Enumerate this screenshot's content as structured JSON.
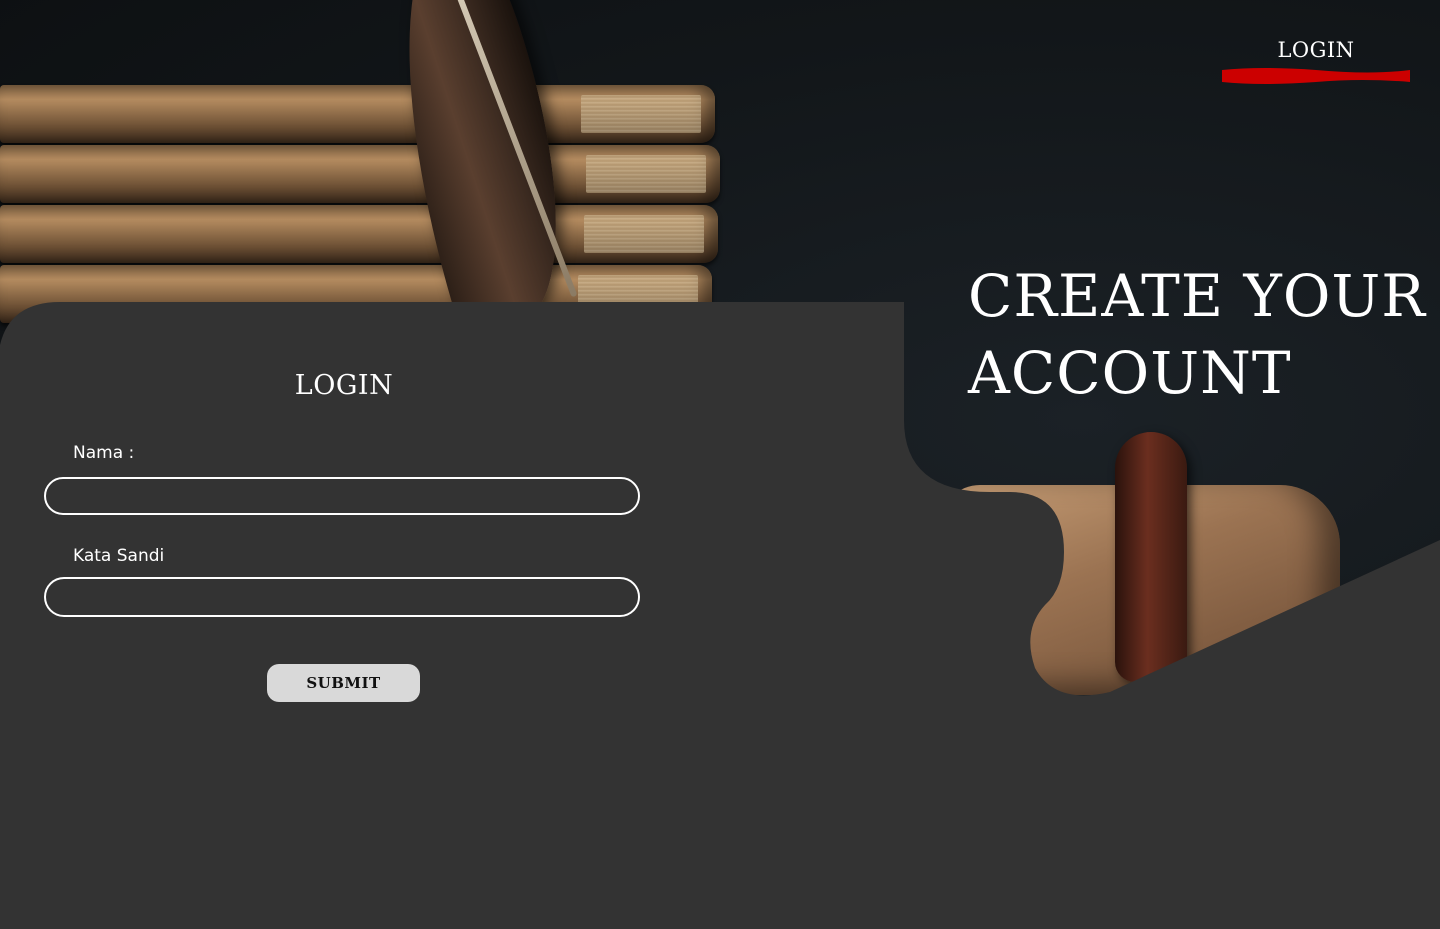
{
  "nav": {
    "login_label": "LOGIN",
    "accent_color": "#cc0000"
  },
  "hero": {
    "headline_line1": "CREATE YOUR",
    "headline_line2": "ACCOUNT"
  },
  "form": {
    "title": "LOGIN",
    "name_label": "Nama :",
    "name_value": "",
    "password_label": "Kata Sandi",
    "password_value": "",
    "submit_label": "SUBMIT"
  },
  "colors": {
    "panel": "#333333",
    "text": "#ffffff",
    "button": "#d9d9d9"
  }
}
